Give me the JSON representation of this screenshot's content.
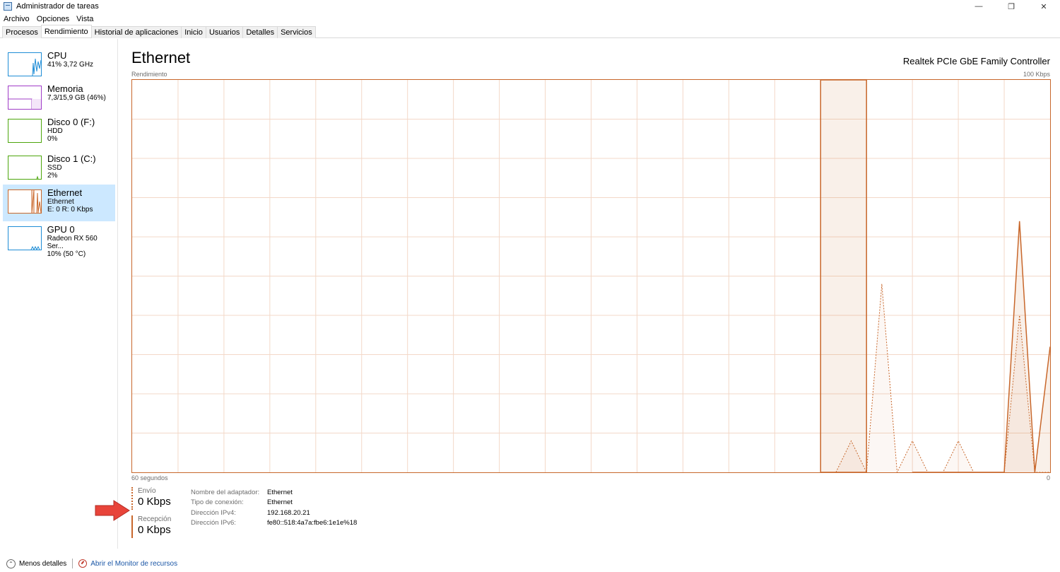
{
  "window": {
    "title": "Administrador de tareas",
    "controls": [
      "—",
      "❐",
      "✕"
    ]
  },
  "menu": [
    "Archivo",
    "Opciones",
    "Vista"
  ],
  "tabs": [
    "Procesos",
    "Rendimiento",
    "Historial de aplicaciones",
    "Inicio",
    "Usuarios",
    "Detalles",
    "Servicios"
  ],
  "active_tab": "Rendimiento",
  "sidebar": {
    "items": [
      {
        "title": "CPU",
        "line1": "41% 3,72 GHz",
        "line2": "",
        "color": "#1f8dd6"
      },
      {
        "title": "Memoria",
        "line1": "7,3/15,9 GB (46%)",
        "line2": "",
        "color": "#a03cc7"
      },
      {
        "title": "Disco 0 (F:)",
        "line1": "HDD",
        "line2": "0%",
        "color": "#4da60c"
      },
      {
        "title": "Disco 1 (C:)",
        "line1": "SSD",
        "line2": "2%",
        "color": "#4da60c"
      },
      {
        "title": "Ethernet",
        "line1": "Ethernet",
        "line2": "E: 0 R: 0 Kbps",
        "color": "#c8672b"
      },
      {
        "title": "GPU 0",
        "line1": "Radeon RX 560 Ser...",
        "line2": "10% (50 °C)",
        "color": "#1f8dd6"
      }
    ]
  },
  "main": {
    "title": "Ethernet",
    "adapter": "Realtek PCIe GbE Family Controller",
    "perf_label": "Rendimiento",
    "max_label": "100 Kbps",
    "time_label": "60 segundos",
    "min_label": "0"
  },
  "chart_data": {
    "type": "area",
    "x_range": [
      60,
      0
    ],
    "ylim": [
      0,
      100
    ],
    "units": "Kbps",
    "grid": true,
    "series": [
      {
        "name": "Envío",
        "style": "dotted",
        "x": [
          14,
          13,
          12,
          11,
          10,
          9,
          8,
          7,
          6,
          5,
          4,
          3,
          2,
          1,
          0
        ],
        "values": [
          0,
          8,
          0,
          48,
          0,
          8,
          0,
          0,
          8,
          0,
          0,
          0,
          40,
          0,
          0
        ]
      },
      {
        "name": "Recepción",
        "style": "solid",
        "x": [
          9,
          8,
          7,
          6,
          5,
          4,
          3,
          2,
          1,
          0
        ],
        "values": [
          0,
          0,
          0,
          0,
          0,
          0,
          0,
          64,
          0,
          32
        ]
      }
    ]
  },
  "stats": {
    "send_label": "Envío",
    "send_value": "0 Kbps",
    "recv_label": "Recepción",
    "recv_value": "0 Kbps"
  },
  "details": [
    {
      "key": "Nombre del adaptador:",
      "value": "Ethernet"
    },
    {
      "key": "Tipo de conexión:",
      "value": "Ethernet"
    },
    {
      "key": "Dirección IPv4:",
      "value": "192.168.20.21"
    },
    {
      "key": "Dirección IPv6:",
      "value": "fe80::518:4a7a:fbe6:1e1e%18"
    }
  ],
  "footer": {
    "fewer_details": "Menos detalles",
    "resource_monitor": "Abrir el Monitor de recursos"
  }
}
